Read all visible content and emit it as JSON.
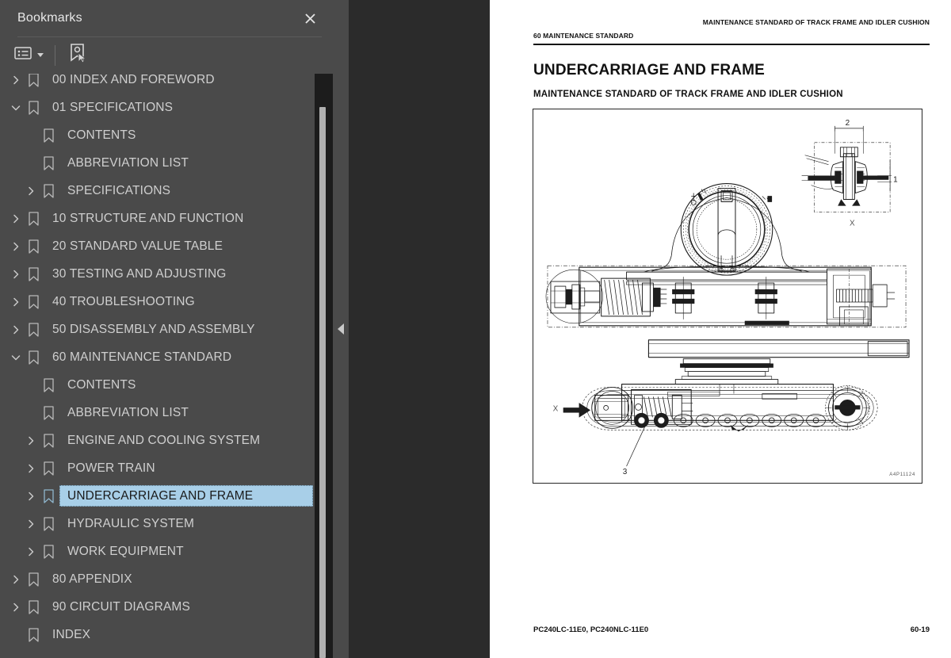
{
  "panel": {
    "title": "Bookmarks",
    "close_icon": "close-icon",
    "toolbar": {
      "options_label": "Options",
      "options_icon": "list-options-icon",
      "dropdown_icon": "chevron-down-icon",
      "new_bookmark_label": "New Bookmark",
      "new_bookmark_icon": "new-bookmark-icon"
    },
    "tree": [
      {
        "label": "00 INDEX AND FOREWORD",
        "level": 0,
        "state": "collapsed",
        "selected": false
      },
      {
        "label": "01 SPECIFICATIONS",
        "level": 0,
        "state": "expanded",
        "selected": false
      },
      {
        "label": "CONTENTS",
        "level": 1,
        "state": "leaf",
        "selected": false
      },
      {
        "label": "ABBREVIATION LIST",
        "level": 1,
        "state": "leaf",
        "selected": false
      },
      {
        "label": "SPECIFICATIONS",
        "level": 1,
        "state": "collapsed",
        "selected": false
      },
      {
        "label": "10 STRUCTURE AND FUNCTION",
        "level": 0,
        "state": "collapsed",
        "selected": false
      },
      {
        "label": "20 STANDARD VALUE TABLE",
        "level": 0,
        "state": "collapsed",
        "selected": false
      },
      {
        "label": "30 TESTING AND ADJUSTING",
        "level": 0,
        "state": "collapsed",
        "selected": false
      },
      {
        "label": "40 TROUBLESHOOTING",
        "level": 0,
        "state": "collapsed",
        "selected": false
      },
      {
        "label": "50 DISASSEMBLY AND ASSEMBLY",
        "level": 0,
        "state": "collapsed",
        "selected": false
      },
      {
        "label": "60 MAINTENANCE STANDARD",
        "level": 0,
        "state": "expanded",
        "selected": false
      },
      {
        "label": "CONTENTS",
        "level": 1,
        "state": "leaf",
        "selected": false
      },
      {
        "label": "ABBREVIATION LIST",
        "level": 1,
        "state": "leaf",
        "selected": false
      },
      {
        "label": "ENGINE AND COOLING SYSTEM",
        "level": 1,
        "state": "collapsed",
        "selected": false
      },
      {
        "label": "POWER TRAIN",
        "level": 1,
        "state": "collapsed",
        "selected": false
      },
      {
        "label": "UNDERCARRIAGE AND FRAME",
        "level": 1,
        "state": "collapsed",
        "selected": true
      },
      {
        "label": "HYDRAULIC SYSTEM",
        "level": 1,
        "state": "collapsed",
        "selected": false
      },
      {
        "label": "WORK EQUIPMENT",
        "level": 1,
        "state": "collapsed",
        "selected": false
      },
      {
        "label": "80 APPENDIX",
        "level": 0,
        "state": "collapsed",
        "selected": false
      },
      {
        "label": "90 CIRCUIT DIAGRAMS",
        "level": 0,
        "state": "collapsed",
        "selected": false
      },
      {
        "label": "INDEX",
        "level": 0,
        "state": "leaf",
        "selected": false
      }
    ],
    "selection_color": "#a8cfe8",
    "background_color": "#4a4a4a"
  },
  "splitter": {
    "collapse_icon": "collapse-panel-arrow-icon"
  },
  "document": {
    "header_left": "60 MAINTENANCE STANDARD",
    "header_right": "MAINTENANCE STANDARD OF TRACK FRAME AND IDLER CUSHION",
    "heading": "UNDERCARRIAGE AND FRAME",
    "subheading": "MAINTENANCE STANDARD OF TRACK FRAME AND IDLER CUSHION",
    "figure": {
      "figure_id": "A4P11124",
      "detail_view_label": "X",
      "section_arrow_label": "X",
      "callouts": [
        "1",
        "2",
        "3"
      ]
    },
    "footer_left": "PC240LC-11E0, PC240NLC-11E0",
    "footer_right": "60-19"
  }
}
